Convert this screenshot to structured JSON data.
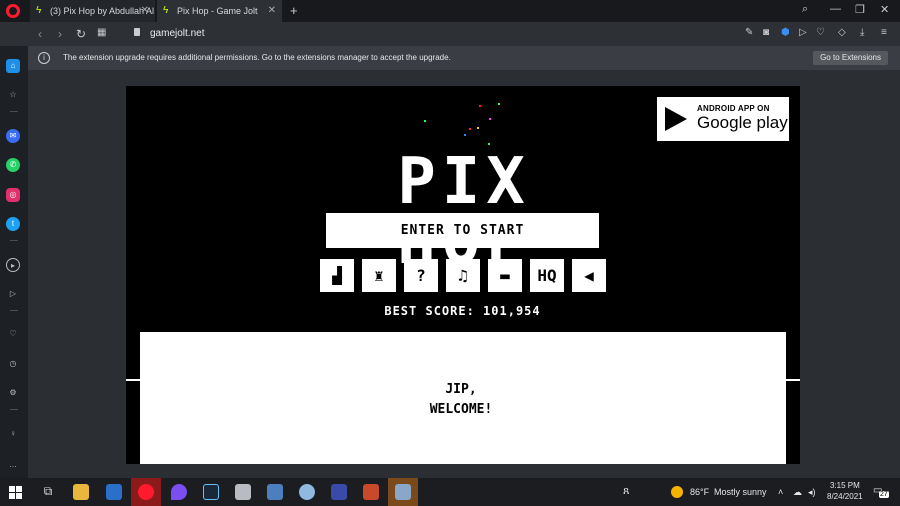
{
  "tabs": [
    {
      "label": "(3) Pix Hop by Abdullah Al"
    },
    {
      "label": "Pix Hop - Game Jolt"
    }
  ],
  "address": {
    "url": "gamejolt.net"
  },
  "notification": {
    "message": "The extension upgrade requires additional permissions. Go to the extensions manager to accept the upgrade.",
    "button": "Go to Extensions"
  },
  "game": {
    "gplay_line1": "ANDROID APP ON",
    "gplay_line2": "Google play",
    "title": "PIX HOP",
    "start_label": "ENTER TO START",
    "icon_buttons": [
      "podium-icon",
      "trophy-icon",
      "?",
      "twitter-icon",
      "keyboard-icon",
      "HQ",
      "speaker-icon"
    ],
    "icon_q": "?",
    "icon_hq": "HQ",
    "best_score": "BEST SCORE: 101,954",
    "welcome_line1": "JIP,",
    "welcome_line2": "WELCOME!"
  },
  "taskbar": {
    "weather_temp": "86°F",
    "weather_text": "Mostly sunny",
    "time": "3:15 PM",
    "date": "8/24/2021",
    "notif_count": "27"
  },
  "colors": {
    "opera_red": "#ff1b2d",
    "gamejolt_green": "#ccff00"
  }
}
